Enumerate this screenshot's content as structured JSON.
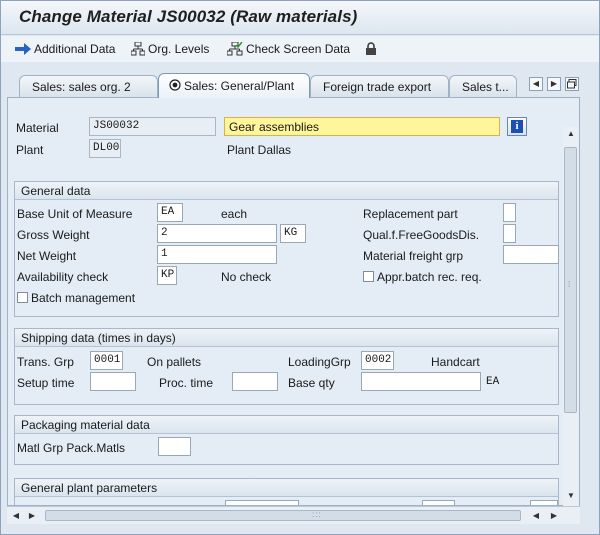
{
  "title": "Change Material JS00032 (Raw materials)",
  "toolbar": {
    "additional_data": "Additional Data",
    "org_levels": "Org. Levels",
    "check_screen_data": "Check Screen Data"
  },
  "tabs": [
    {
      "label": "Sales: sales org. 2",
      "active": false
    },
    {
      "label": "Sales: General/Plant",
      "active": true
    },
    {
      "label": "Foreign trade export",
      "active": false
    },
    {
      "label": "Sales t...",
      "active": false
    }
  ],
  "header": {
    "material_label": "Material",
    "material_value": "JS00032",
    "material_desc": "Gear assemblies",
    "plant_label": "Plant",
    "plant_value": "DL00",
    "plant_desc": "Plant Dallas",
    "info_glyph": "i"
  },
  "general_data": {
    "title": "General data",
    "base_uom_label": "Base Unit of Measure",
    "base_uom_value": "EA",
    "base_uom_text": "each",
    "gross_weight_label": "Gross Weight",
    "gross_weight_value": "2",
    "weight_unit": "KG",
    "net_weight_label": "Net Weight",
    "net_weight_value": "1",
    "availability_label": "Availability check",
    "availability_value": "KP",
    "availability_text": "No check",
    "batch_mgmt_label": "Batch management",
    "replacement_label": "Replacement part",
    "replacement_value": "",
    "qual_free_label": "Qual.f.FreeGoodsDis.",
    "qual_free_value": "",
    "freight_grp_label": "Material freight grp",
    "freight_grp_value": "",
    "appr_batch_label": "Appr.batch rec. req."
  },
  "shipping_data": {
    "title": "Shipping data (times in days)",
    "trans_grp_label": "Trans. Grp",
    "trans_grp_value": "0001",
    "trans_grp_text": "On pallets",
    "loading_grp_label": "LoadingGrp",
    "loading_grp_value": "0002",
    "loading_grp_text": "Handcart",
    "setup_time_label": "Setup time",
    "setup_time_value": "",
    "proc_time_label": "Proc. time",
    "proc_time_value": "",
    "base_qty_label": "Base qty",
    "base_qty_value": "",
    "base_qty_unit": "EA"
  },
  "packaging": {
    "title": "Packaging material data",
    "matl_grp_label": "Matl Grp Pack.Matls",
    "matl_grp_value": ""
  },
  "plant_params": {
    "title": "General plant parameters"
  },
  "scroll": {
    "up": "▲",
    "down": "▼",
    "left": "◀",
    "right": "▶",
    "grip_v": "⁞",
    "grip_h": ":::"
  },
  "colors": {
    "accent": "#1c4fb3",
    "highlight": "#fff59a",
    "background": "#dfe8f1"
  }
}
